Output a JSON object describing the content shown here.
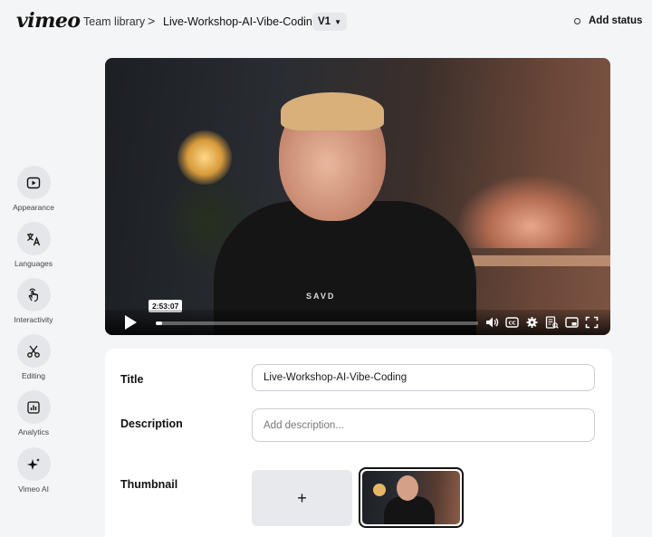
{
  "header": {
    "logo": "vimeo",
    "breadcrumb_team": "Team library",
    "breadcrumb_separator": ">",
    "breadcrumb_current": "Live-Workshop-AI-Vibe-Coding",
    "version": "V1",
    "status_label": "Add status"
  },
  "sidebar": {
    "items": [
      {
        "label": "Appearance",
        "icon": "play-square-icon"
      },
      {
        "label": "Languages",
        "icon": "translate-icon"
      },
      {
        "label": "Interactivity",
        "icon": "tap-hand-icon"
      },
      {
        "label": "Editing",
        "icon": "scissors-icon"
      },
      {
        "label": "Analytics",
        "icon": "bar-chart-icon"
      },
      {
        "label": "Vimeo AI",
        "icon": "sparkle-icon"
      }
    ]
  },
  "video": {
    "timecode": "2:53:07",
    "shirt_text": "SAVD",
    "progress_fraction": 0.02
  },
  "details": {
    "title_label": "Title",
    "title_value": "Live-Workshop-AI-Vibe-Coding",
    "description_label": "Description",
    "description_placeholder": "Add description...",
    "thumbnail_label": "Thumbnail",
    "add_thumbnail": "+"
  },
  "colors": {
    "background": "#f4f5f7",
    "panel": "#ffffff",
    "chip": "#e4e6ea"
  }
}
